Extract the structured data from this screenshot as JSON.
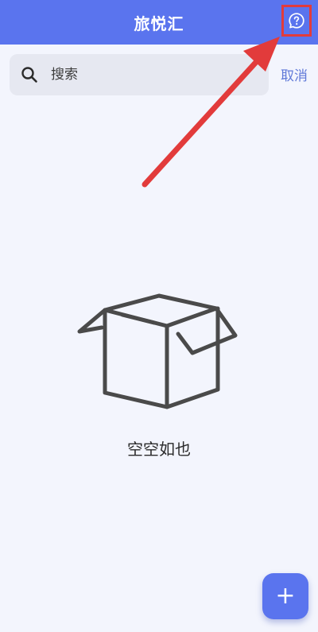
{
  "header": {
    "title": "旅悦汇",
    "help_icon": "question-circle-icon"
  },
  "search": {
    "placeholder": "搜索",
    "value": "",
    "cancel_label": "取消",
    "icon": "search-icon"
  },
  "empty_state": {
    "icon": "open-box-icon",
    "message": "空空如也"
  },
  "fab": {
    "label": "+",
    "icon": "plus-icon"
  },
  "annotation": {
    "icon": "red-arrow-icon",
    "color": "#e23b3b"
  },
  "colors": {
    "primary": "#5a74ee",
    "background": "#f3f5fd",
    "search_bg": "#e6e8f1",
    "cancel_text": "#6079d8",
    "annotation": "#e23b3b"
  }
}
